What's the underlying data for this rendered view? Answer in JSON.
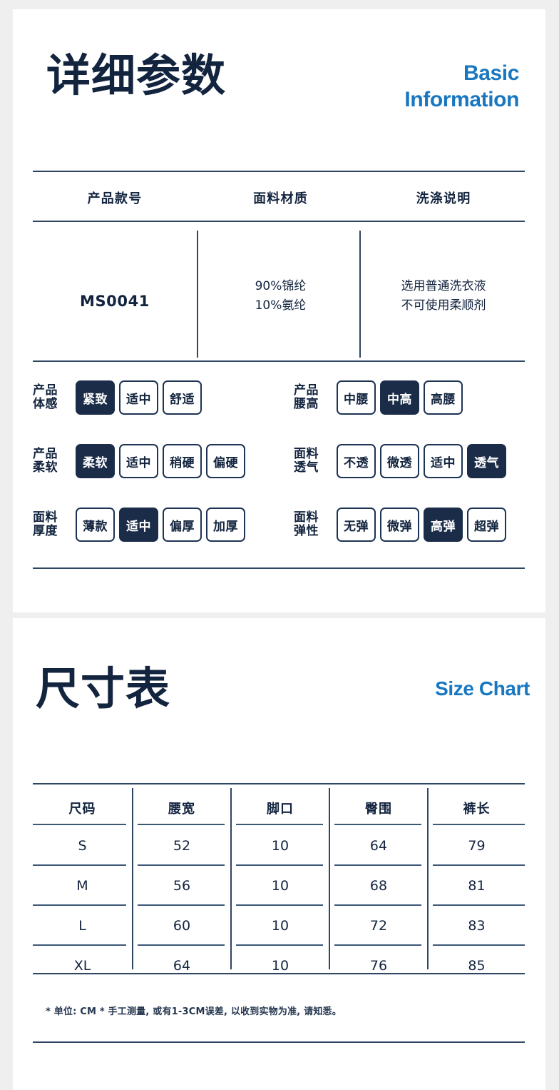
{
  "theme": {
    "page_bg": "#efefef",
    "card_bg": "#ffffff",
    "navy": "#13243f",
    "chip_on_bg": "#1a2c48",
    "accent_blue": "#1877c0",
    "rule": "#2f4663"
  },
  "basic": {
    "title_cn": "详细参数",
    "title_en": "Basic\nInformation",
    "table": {
      "headers": [
        "产品款号",
        "面料材质",
        "洗涤说明"
      ],
      "row": [
        "MS0041",
        "90%锦纶\n10%氨纶",
        "选用普通洗衣液\n不可使用柔顺剂"
      ]
    },
    "attributes_left": [
      {
        "label": "产品\n体感",
        "options": [
          "紧致",
          "适中",
          "舒适"
        ],
        "selected": 0
      },
      {
        "label": "产品\n柔软",
        "options": [
          "柔软",
          "适中",
          "稍硬",
          "偏硬"
        ],
        "selected": 0
      },
      {
        "label": "面料\n厚度",
        "options": [
          "薄款",
          "适中",
          "偏厚",
          "加厚"
        ],
        "selected": 1
      }
    ],
    "attributes_right": [
      {
        "label": "产品\n腰高",
        "options": [
          "中腰",
          "中高",
          "高腰"
        ],
        "selected": 1
      },
      {
        "label": "面料\n透气",
        "options": [
          "不透",
          "微透",
          "适中",
          "透气"
        ],
        "selected": 3
      },
      {
        "label": "面料\n弹性",
        "options": [
          "无弹",
          "微弹",
          "高弹",
          "超弹"
        ],
        "selected": 2
      }
    ]
  },
  "size": {
    "title_cn": "尺寸表",
    "title_en": "Size Chart",
    "headers": [
      "尺码",
      "腰宽",
      "脚口",
      "臀围",
      "裤长"
    ],
    "rows": [
      [
        "S",
        "52",
        "10",
        "64",
        "79"
      ],
      [
        "M",
        "56",
        "10",
        "68",
        "81"
      ],
      [
        "L",
        "60",
        "10",
        "72",
        "83"
      ],
      [
        "XL",
        "64",
        "10",
        "76",
        "85"
      ]
    ],
    "note": "* 单位: CM * 手工测量, 或有1-3CM误差, 以收到实物为准, 请知悉。"
  }
}
